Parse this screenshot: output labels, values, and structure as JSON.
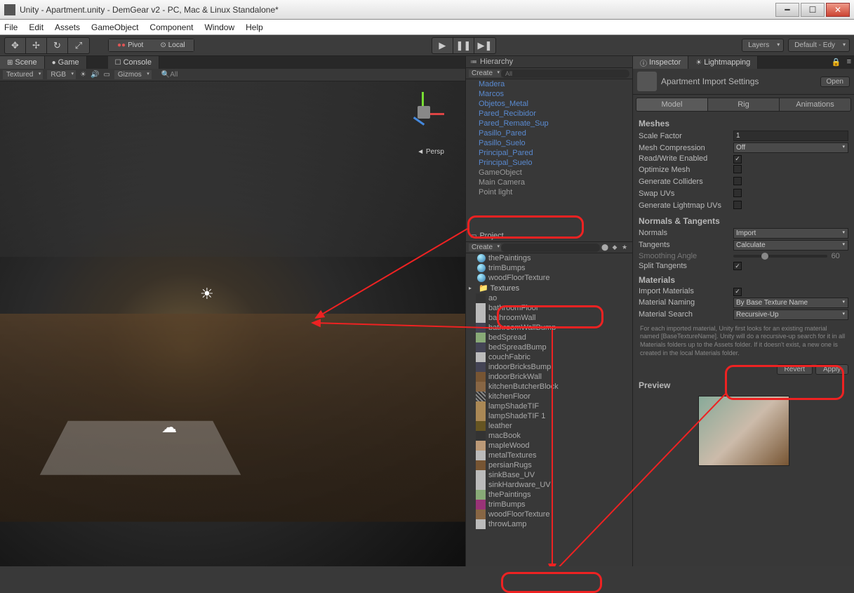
{
  "window": {
    "title": "Unity - Apartment.unity - DemGear v2 - PC, Mac & Linux Standalone*"
  },
  "menu": [
    "File",
    "Edit",
    "Assets",
    "GameObject",
    "Component",
    "Window",
    "Help"
  ],
  "toolbar": {
    "pivot": "Pivot",
    "local": "Local",
    "layers": "Layers",
    "layout": "Default - Edy"
  },
  "sceneTabs": {
    "scene": "Scene",
    "game": "Game",
    "console": "Console"
  },
  "sceneToolbar": {
    "shading": "Textured",
    "renderMode": "RGB",
    "gizmos": "Gizmos",
    "search": "All",
    "persp": "Persp"
  },
  "hierarchy": {
    "title": "Hierarchy",
    "create": "Create",
    "items": [
      {
        "label": "Madera",
        "cls": ""
      },
      {
        "label": "Marcos",
        "cls": ""
      },
      {
        "label": "Objetos_Metal",
        "cls": ""
      },
      {
        "label": "Pared_Recibidor",
        "cls": ""
      },
      {
        "label": "Pared_Remate_Sup",
        "cls": ""
      },
      {
        "label": "Pasillo_Pared",
        "cls": ""
      },
      {
        "label": "Pasillo_Suelo",
        "cls": ""
      },
      {
        "label": "Principal_Pared",
        "cls": ""
      },
      {
        "label": "Principal_Suelo",
        "cls": ""
      },
      {
        "label": "GameObject",
        "cls": "gray"
      },
      {
        "label": "Main Camera",
        "cls": "gray"
      },
      {
        "label": "Point light",
        "cls": "gray"
      }
    ]
  },
  "project": {
    "title": "Project",
    "create": "Create",
    "materials": [
      "thePaintings",
      "trimBumps",
      "woodFloorTexture"
    ],
    "folder": "Textures",
    "textures": [
      {
        "label": "ao",
        "t": "t1"
      },
      {
        "label": "bathroomFloor",
        "t": "t4"
      },
      {
        "label": "bathroomWall",
        "t": "t4"
      },
      {
        "label": "bathroomWallBump",
        "t": "t5"
      },
      {
        "label": "bedSpread",
        "t": "t2"
      },
      {
        "label": "bedSpreadBump",
        "t": "t5"
      },
      {
        "label": "couchFabric",
        "t": "t4"
      },
      {
        "label": "indoorBricksBump",
        "t": "t5"
      },
      {
        "label": "indoorBrickWall",
        "t": "t3"
      },
      {
        "label": "kitchenButcherBlock",
        "t": "t7"
      },
      {
        "label": "kitchenFloor",
        "t": "t6"
      },
      {
        "label": "lampShadeTIF",
        "t": "t8"
      },
      {
        "label": "lampShadeTIF 1",
        "t": "t8"
      },
      {
        "label": "leather",
        "t": "t10"
      },
      {
        "label": "macBook",
        "t": "t1"
      },
      {
        "label": "mapleWood",
        "t": "t9"
      },
      {
        "label": "metalTextures",
        "t": "t4"
      },
      {
        "label": "persianRugs",
        "t": "t3"
      },
      {
        "label": "sinkBase_UV",
        "t": "t4"
      },
      {
        "label": "sinkHardware_UV",
        "t": "t4"
      },
      {
        "label": "thePaintings",
        "t": "t2"
      },
      {
        "label": "trimBumps",
        "t": "t11"
      },
      {
        "label": "woodFloorTexture",
        "t": "t7"
      },
      {
        "label": "throwLamp",
        "t": "t4"
      }
    ]
  },
  "inspector": {
    "tab1": "Inspector",
    "tab2": "Lightmapping",
    "title": "Apartment Import Settings",
    "open": "Open",
    "modelTabs": [
      "Model",
      "Rig",
      "Animations"
    ],
    "meshes": {
      "title": "Meshes",
      "scaleFactor": {
        "label": "Scale Factor",
        "value": "1"
      },
      "meshCompression": {
        "label": "Mesh Compression",
        "value": "Off"
      },
      "readWrite": {
        "label": "Read/Write Enabled",
        "checked": true
      },
      "optimize": {
        "label": "Optimize Mesh",
        "checked": false
      },
      "colliders": {
        "label": "Generate Colliders",
        "checked": false
      },
      "swapUVs": {
        "label": "Swap UVs",
        "checked": false
      },
      "lightmapUVs": {
        "label": "Generate Lightmap UVs",
        "checked": false
      }
    },
    "normals": {
      "title": "Normals & Tangents",
      "normals": {
        "label": "Normals",
        "value": "Import"
      },
      "tangents": {
        "label": "Tangents",
        "value": "Calculate"
      },
      "smoothing": {
        "label": "Smoothing Angle",
        "value": "60"
      },
      "split": {
        "label": "Split Tangents",
        "checked": true
      }
    },
    "materials": {
      "title": "Materials",
      "import": {
        "label": "Import Materials",
        "checked": true
      },
      "naming": {
        "label": "Material Naming",
        "value": "By Base Texture Name"
      },
      "search": {
        "label": "Material Search",
        "value": "Recursive-Up"
      },
      "help": "For each imported material, Unity first looks for an existing material named [BaseTextureName]. Unity will do a recursive-up search for it in all Materials folders up to the Assets folder. If it doesn't exist, a new one is created in the local Materials folder."
    },
    "revert": "Revert",
    "apply": "Apply",
    "preview": "Preview"
  }
}
